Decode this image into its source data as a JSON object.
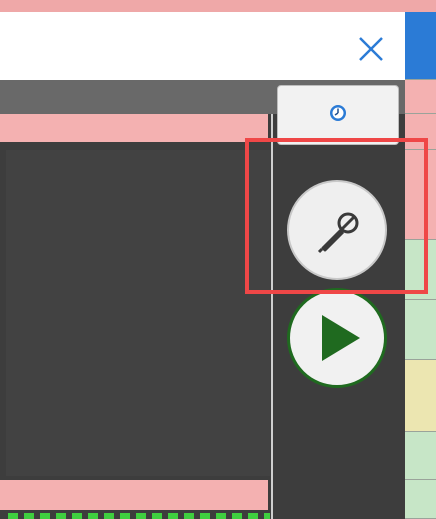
{
  "dialog": {
    "close_icon": "close-x-icon"
  },
  "toolbar": {
    "metronome_icon": "metronome-clock-icon",
    "record_icon": "microphone-icon",
    "play_icon": "play-triangle-icon"
  },
  "colors": {
    "pink": "#f4b1b1",
    "dark_bg": "#3d3d3d",
    "play_green": "#1f6a1f",
    "highlight_red": "#ef4747",
    "accent_blue": "#2b7bd6"
  },
  "right_column_swatches": [
    "#2b7bd6",
    "#f4b1b1",
    "#f4b1b1",
    "#f4b1b1",
    "#c7e6c7",
    "#c7e6c7",
    "#ece6b1",
    "#c7e6c7",
    "#c7e6c7"
  ]
}
